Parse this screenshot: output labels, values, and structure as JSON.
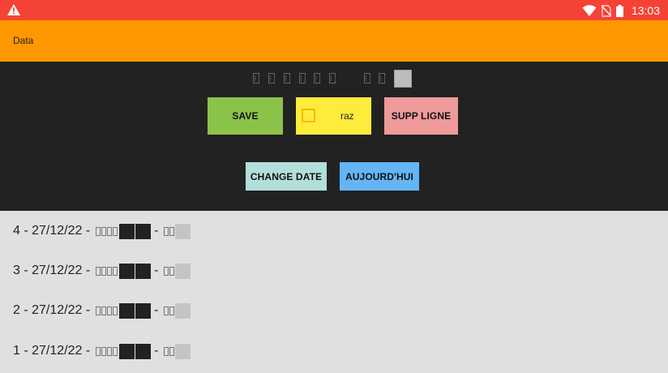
{
  "status_bar": {
    "time": "13:03",
    "icons": [
      "warning-icon",
      "wifi-icon",
      "no-sim-icon",
      "battery-icon"
    ],
    "colors": {
      "bar": "#f44336"
    }
  },
  "app_bar": {
    "title": "Data",
    "color": "#ff9800"
  },
  "controls": {
    "save_label": "SAVE",
    "raz_label": "raz",
    "raz_checked": false,
    "supp_label": "SUPP LIGNE",
    "change_date_label": "CHANGE DATE",
    "today_label": "AUJOURD'HUI",
    "colors": {
      "save": "#8bc34a",
      "raz": "#ffeb3b",
      "supp": "#ef9a9a",
      "change_date": "#b2dfdb",
      "today": "#64b5f6",
      "panel": "#222222"
    }
  },
  "entries": [
    {
      "id": "4",
      "date": "27/12/22",
      "sep1": " - ",
      "sep2": " - ",
      "sep3": " - "
    },
    {
      "id": "3",
      "date": "27/12/22",
      "sep1": " - ",
      "sep2": " - ",
      "sep3": " - "
    },
    {
      "id": "2",
      "date": "27/12/22",
      "sep1": " - ",
      "sep2": " - ",
      "sep3": " - "
    },
    {
      "id": "1",
      "date": "27/12/22",
      "sep1": " - ",
      "sep2": " - ",
      "sep3": " - "
    }
  ]
}
